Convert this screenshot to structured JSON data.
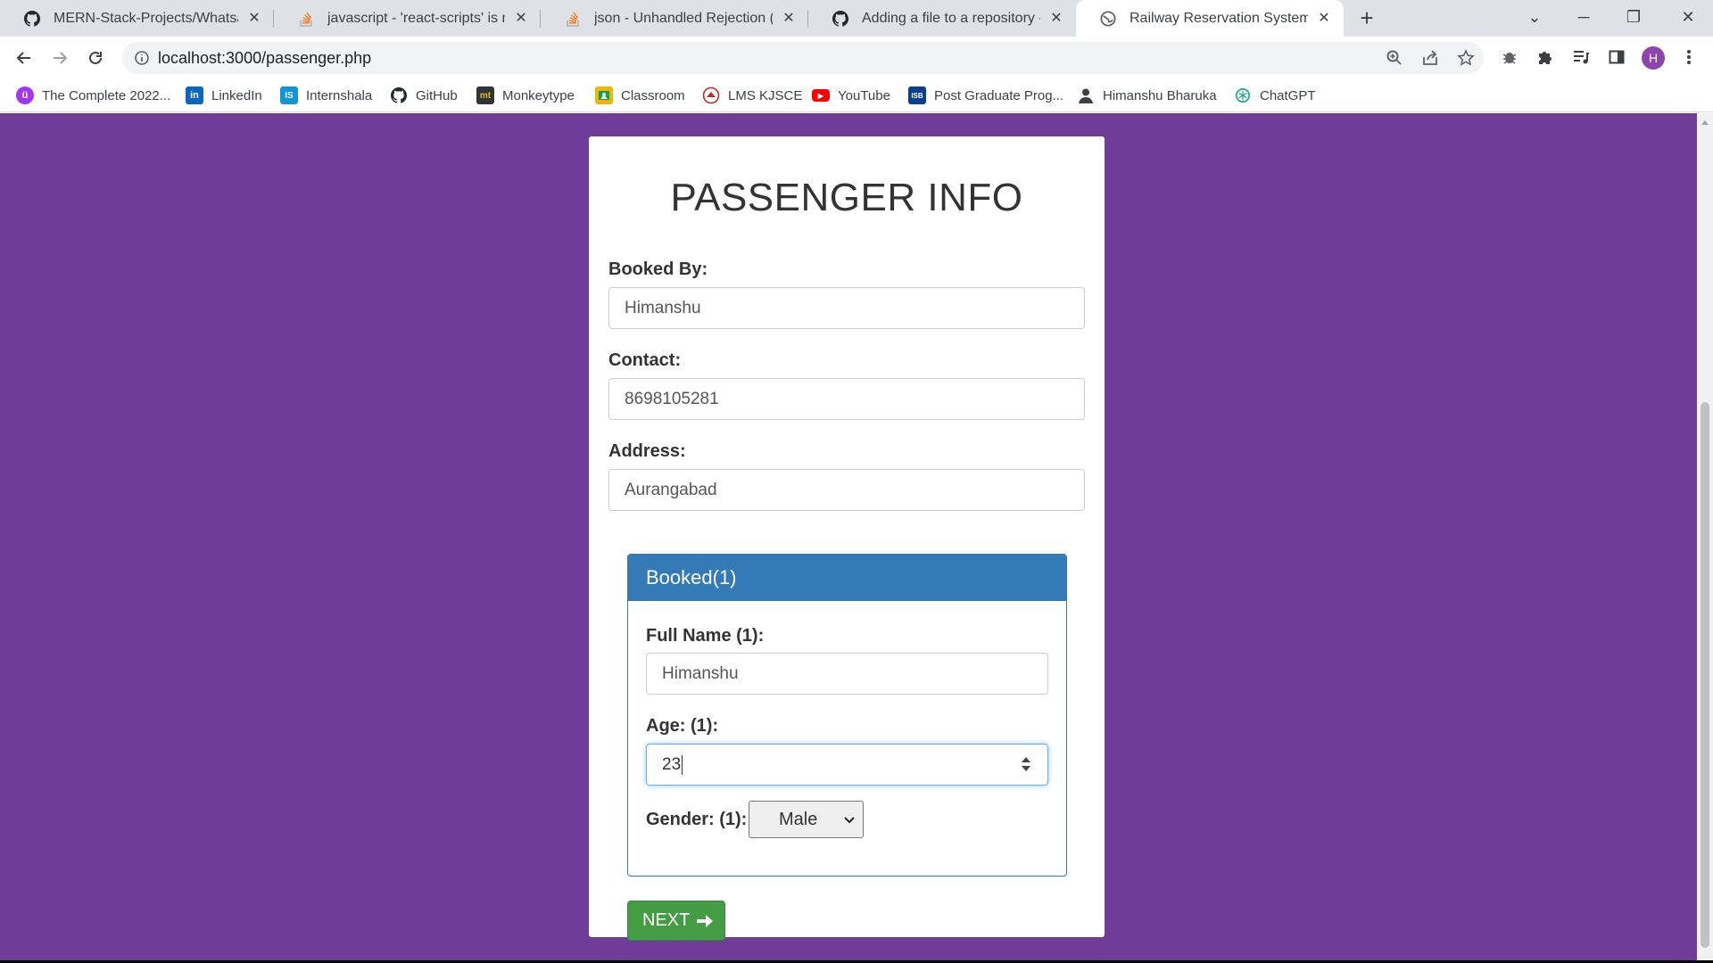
{
  "tabs": [
    {
      "title": "MERN-Stack-Projects/Whatsapp",
      "icon": "github-icon"
    },
    {
      "title": "javascript - 'react-scripts' is not r",
      "icon": "stackoverflow-icon"
    },
    {
      "title": "json - Unhandled Rejection (Type",
      "icon": "stackoverflow-icon"
    },
    {
      "title": "Adding a file to a repository - Git",
      "icon": "github-icon"
    },
    {
      "title": "Railway Reservation System",
      "icon": "globe-icon",
      "active": true
    }
  ],
  "address_bar": {
    "url": "localhost:3000/passenger.php"
  },
  "profile": {
    "initial": "H",
    "color": "#8e44ad"
  },
  "bookmarks": [
    {
      "label": "The Complete 2022...",
      "icon": "udemy-icon",
      "color": "#a435f0",
      "glyph": "ü"
    },
    {
      "label": "LinkedIn",
      "icon": "linkedin-icon",
      "color": "#0a66c2",
      "glyph": "in"
    },
    {
      "label": "Internshala",
      "icon": "internshala-icon",
      "color": "#1295d8",
      "glyph": "IS"
    },
    {
      "label": "GitHub",
      "icon": "github-icon",
      "color": "#ffffff",
      "glyph": ""
    },
    {
      "label": "Monkeytype",
      "icon": "monkeytype-icon",
      "color": "#323437",
      "glyph": "mt"
    },
    {
      "label": "Classroom",
      "icon": "classroom-icon",
      "color": "#f4b400",
      "glyph": ""
    },
    {
      "label": "LMS KJSCE",
      "icon": "lms-icon",
      "color": "#c62828",
      "glyph": ""
    },
    {
      "label": "YouTube",
      "icon": "youtube-icon",
      "color": "#ff0000",
      "glyph": "▶"
    },
    {
      "label": "Post Graduate Prog...",
      "icon": "isb-icon",
      "color": "#0b3d91",
      "glyph": "ISB"
    },
    {
      "label": "Himanshu Bharuka",
      "icon": "person-icon",
      "color": "#555555",
      "glyph": ""
    },
    {
      "label": "ChatGPT",
      "icon": "chatgpt-icon",
      "color": "#10a37f",
      "glyph": ""
    }
  ],
  "page": {
    "title": "PASSENGER INFO",
    "booked_by": {
      "label": "Booked By:",
      "value": "Himanshu"
    },
    "contact": {
      "label": "Contact:",
      "value": "8698105281"
    },
    "address": {
      "label": "Address:",
      "value": "Aurangabad"
    },
    "panel": {
      "heading": "Booked(1)",
      "full_name": {
        "label": "Full Name (1):",
        "value": "Himanshu"
      },
      "age": {
        "label": "Age: (1):",
        "value": "23"
      },
      "gender": {
        "label": "Gender: (1):",
        "selected": "Male"
      }
    },
    "next_button": "NEXT"
  },
  "colors": {
    "page_background": "#6f3d98",
    "panel_primary": "#337ab7",
    "button_success": "#449d44"
  }
}
